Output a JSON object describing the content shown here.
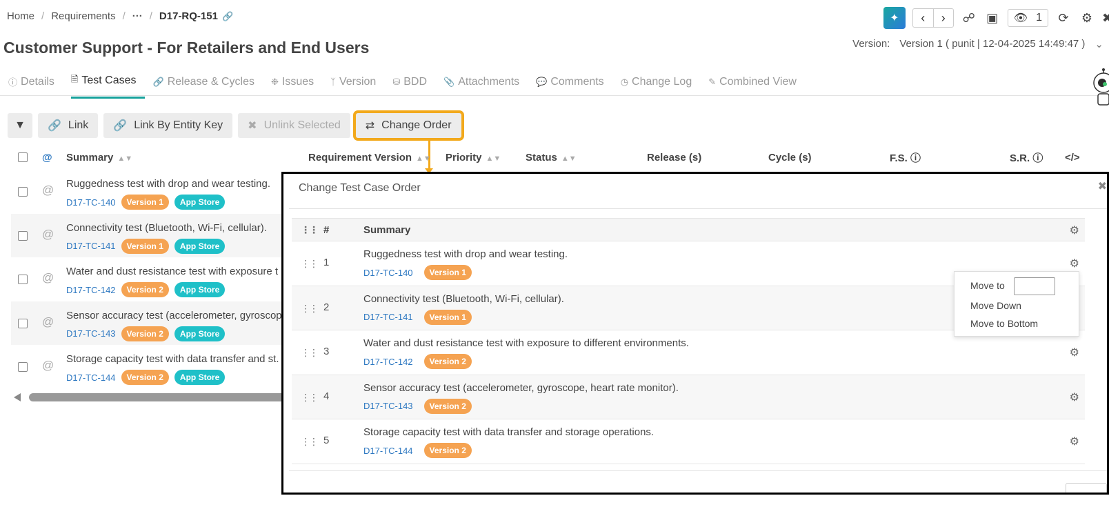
{
  "breadcrumb": {
    "home": "Home",
    "requirements": "Requirements",
    "ellipsis": "···",
    "current": "D17-RQ-151"
  },
  "page_title": "Customer Support - For Retailers and End Users",
  "header": {
    "watch_count": "1"
  },
  "version": {
    "label": "Version:",
    "value": "Version 1 ( punit | 12-04-2025 14:49:47 )"
  },
  "tabs": [
    {
      "label": "Details",
      "icon": "info-icon"
    },
    {
      "label": "Test Cases",
      "icon": "document-icon"
    },
    {
      "label": "Release & Cycles",
      "icon": "link-icon"
    },
    {
      "label": "Issues",
      "icon": "bug-icon"
    },
    {
      "label": "Version",
      "icon": "branch-icon"
    },
    {
      "label": "BDD",
      "icon": "database-icon"
    },
    {
      "label": "Attachments",
      "icon": "paperclip-icon"
    },
    {
      "label": "Comments",
      "icon": "comments-icon"
    },
    {
      "label": "Change Log",
      "icon": "clock-icon"
    },
    {
      "label": "Combined View",
      "icon": "pencil-icon"
    }
  ],
  "toolbar": {
    "link": "Link",
    "link_by_key": "Link By Entity Key",
    "unlink_selected": "Unlink Selected",
    "change_order": "Change Order"
  },
  "table": {
    "columns": {
      "at": "@",
      "summary": "Summary",
      "req_version": "Requirement Version",
      "priority": "Priority",
      "status": "Status",
      "release": "Release (s)",
      "cycle": "Cycle (s)",
      "fs": "F.S.",
      "sr": "S.R.",
      "code": "</>"
    },
    "rows": [
      {
        "summary": "Ruggedness test with drop and wear testing.",
        "key": "D17-TC-140",
        "version": "Version 1",
        "tag": "App Store"
      },
      {
        "summary": "Connectivity test (Bluetooth, Wi-Fi, cellular).",
        "key": "D17-TC-141",
        "version": "Version 1",
        "tag": "App Store"
      },
      {
        "summary": "Water and dust resistance test with exposure t",
        "key": "D17-TC-142",
        "version": "Version 2",
        "tag": "App Store"
      },
      {
        "summary": "Sensor accuracy test (accelerometer, gyroscop.",
        "key": "D17-TC-143",
        "version": "Version 2",
        "tag": "App Store"
      },
      {
        "summary": "Storage capacity test with data transfer and st.",
        "key": "D17-TC-144",
        "version": "Version 2",
        "tag": "App Store"
      }
    ]
  },
  "modal": {
    "title": "Change Test Case Order",
    "columns": {
      "num": "#",
      "summary": "Summary"
    },
    "rows": [
      {
        "num": "1",
        "summary": "Ruggedness test with drop and wear testing.",
        "key": "D17-TC-140",
        "version": "Version 1"
      },
      {
        "num": "2",
        "summary": "Connectivity test (Bluetooth, Wi-Fi, cellular).",
        "key": "D17-TC-141",
        "version": "Version 1"
      },
      {
        "num": "3",
        "summary": "Water and dust resistance test with exposure to different environments.",
        "key": "D17-TC-142",
        "version": "Version 2"
      },
      {
        "num": "4",
        "summary": "Sensor accuracy test (accelerometer, gyroscope, heart rate monitor).",
        "key": "D17-TC-143",
        "version": "Version 2"
      },
      {
        "num": "5",
        "summary": "Storage capacity test with data transfer and storage operations.",
        "key": "D17-TC-144",
        "version": "Version 2"
      }
    ]
  },
  "popover": {
    "move_to": "Move to",
    "move_down": "Move Down",
    "move_to_bottom": "Move to Bottom"
  },
  "colors": {
    "accent": "#16a29c",
    "highlight": "#f2a91c",
    "version_pill": "#f5a352",
    "app_pill": "#1fc0c8",
    "link": "#2d78c1"
  }
}
